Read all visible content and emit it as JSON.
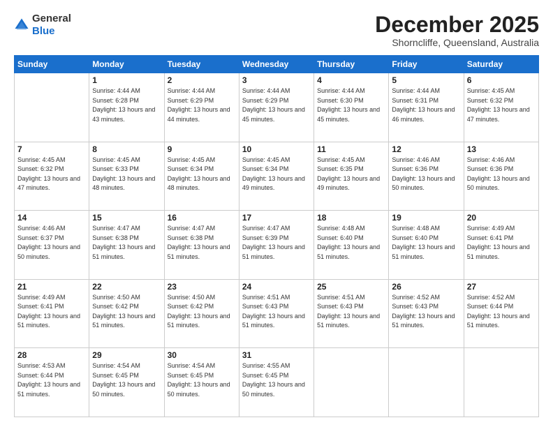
{
  "header": {
    "logo": {
      "general": "General",
      "blue": "Blue"
    },
    "title": "December 2025",
    "subtitle": "Shorncliffe, Queensland, Australia"
  },
  "calendar": {
    "weekdays": [
      "Sunday",
      "Monday",
      "Tuesday",
      "Wednesday",
      "Thursday",
      "Friday",
      "Saturday"
    ],
    "weeks": [
      [
        {
          "day": "",
          "empty": true
        },
        {
          "day": "1",
          "sunrise": "Sunrise: 4:44 AM",
          "sunset": "Sunset: 6:28 PM",
          "daylight": "Daylight: 13 hours and 43 minutes."
        },
        {
          "day": "2",
          "sunrise": "Sunrise: 4:44 AM",
          "sunset": "Sunset: 6:29 PM",
          "daylight": "Daylight: 13 hours and 44 minutes."
        },
        {
          "day": "3",
          "sunrise": "Sunrise: 4:44 AM",
          "sunset": "Sunset: 6:29 PM",
          "daylight": "Daylight: 13 hours and 45 minutes."
        },
        {
          "day": "4",
          "sunrise": "Sunrise: 4:44 AM",
          "sunset": "Sunset: 6:30 PM",
          "daylight": "Daylight: 13 hours and 45 minutes."
        },
        {
          "day": "5",
          "sunrise": "Sunrise: 4:44 AM",
          "sunset": "Sunset: 6:31 PM",
          "daylight": "Daylight: 13 hours and 46 minutes."
        },
        {
          "day": "6",
          "sunrise": "Sunrise: 4:45 AM",
          "sunset": "Sunset: 6:32 PM",
          "daylight": "Daylight: 13 hours and 47 minutes."
        }
      ],
      [
        {
          "day": "7",
          "sunrise": "Sunrise: 4:45 AM",
          "sunset": "Sunset: 6:32 PM",
          "daylight": "Daylight: 13 hours and 47 minutes."
        },
        {
          "day": "8",
          "sunrise": "Sunrise: 4:45 AM",
          "sunset": "Sunset: 6:33 PM",
          "daylight": "Daylight: 13 hours and 48 minutes."
        },
        {
          "day": "9",
          "sunrise": "Sunrise: 4:45 AM",
          "sunset": "Sunset: 6:34 PM",
          "daylight": "Daylight: 13 hours and 48 minutes."
        },
        {
          "day": "10",
          "sunrise": "Sunrise: 4:45 AM",
          "sunset": "Sunset: 6:34 PM",
          "daylight": "Daylight: 13 hours and 49 minutes."
        },
        {
          "day": "11",
          "sunrise": "Sunrise: 4:45 AM",
          "sunset": "Sunset: 6:35 PM",
          "daylight": "Daylight: 13 hours and 49 minutes."
        },
        {
          "day": "12",
          "sunrise": "Sunrise: 4:46 AM",
          "sunset": "Sunset: 6:36 PM",
          "daylight": "Daylight: 13 hours and 50 minutes."
        },
        {
          "day": "13",
          "sunrise": "Sunrise: 4:46 AM",
          "sunset": "Sunset: 6:36 PM",
          "daylight": "Daylight: 13 hours and 50 minutes."
        }
      ],
      [
        {
          "day": "14",
          "sunrise": "Sunrise: 4:46 AM",
          "sunset": "Sunset: 6:37 PM",
          "daylight": "Daylight: 13 hours and 50 minutes."
        },
        {
          "day": "15",
          "sunrise": "Sunrise: 4:47 AM",
          "sunset": "Sunset: 6:38 PM",
          "daylight": "Daylight: 13 hours and 51 minutes."
        },
        {
          "day": "16",
          "sunrise": "Sunrise: 4:47 AM",
          "sunset": "Sunset: 6:38 PM",
          "daylight": "Daylight: 13 hours and 51 minutes."
        },
        {
          "day": "17",
          "sunrise": "Sunrise: 4:47 AM",
          "sunset": "Sunset: 6:39 PM",
          "daylight": "Daylight: 13 hours and 51 minutes."
        },
        {
          "day": "18",
          "sunrise": "Sunrise: 4:48 AM",
          "sunset": "Sunset: 6:40 PM",
          "daylight": "Daylight: 13 hours and 51 minutes."
        },
        {
          "day": "19",
          "sunrise": "Sunrise: 4:48 AM",
          "sunset": "Sunset: 6:40 PM",
          "daylight": "Daylight: 13 hours and 51 minutes."
        },
        {
          "day": "20",
          "sunrise": "Sunrise: 4:49 AM",
          "sunset": "Sunset: 6:41 PM",
          "daylight": "Daylight: 13 hours and 51 minutes."
        }
      ],
      [
        {
          "day": "21",
          "sunrise": "Sunrise: 4:49 AM",
          "sunset": "Sunset: 6:41 PM",
          "daylight": "Daylight: 13 hours and 51 minutes."
        },
        {
          "day": "22",
          "sunrise": "Sunrise: 4:50 AM",
          "sunset": "Sunset: 6:42 PM",
          "daylight": "Daylight: 13 hours and 51 minutes."
        },
        {
          "day": "23",
          "sunrise": "Sunrise: 4:50 AM",
          "sunset": "Sunset: 6:42 PM",
          "daylight": "Daylight: 13 hours and 51 minutes."
        },
        {
          "day": "24",
          "sunrise": "Sunrise: 4:51 AM",
          "sunset": "Sunset: 6:43 PM",
          "daylight": "Daylight: 13 hours and 51 minutes."
        },
        {
          "day": "25",
          "sunrise": "Sunrise: 4:51 AM",
          "sunset": "Sunset: 6:43 PM",
          "daylight": "Daylight: 13 hours and 51 minutes."
        },
        {
          "day": "26",
          "sunrise": "Sunrise: 4:52 AM",
          "sunset": "Sunset: 6:43 PM",
          "daylight": "Daylight: 13 hours and 51 minutes."
        },
        {
          "day": "27",
          "sunrise": "Sunrise: 4:52 AM",
          "sunset": "Sunset: 6:44 PM",
          "daylight": "Daylight: 13 hours and 51 minutes."
        }
      ],
      [
        {
          "day": "28",
          "sunrise": "Sunrise: 4:53 AM",
          "sunset": "Sunset: 6:44 PM",
          "daylight": "Daylight: 13 hours and 51 minutes."
        },
        {
          "day": "29",
          "sunrise": "Sunrise: 4:54 AM",
          "sunset": "Sunset: 6:45 PM",
          "daylight": "Daylight: 13 hours and 50 minutes."
        },
        {
          "day": "30",
          "sunrise": "Sunrise: 4:54 AM",
          "sunset": "Sunset: 6:45 PM",
          "daylight": "Daylight: 13 hours and 50 minutes."
        },
        {
          "day": "31",
          "sunrise": "Sunrise: 4:55 AM",
          "sunset": "Sunset: 6:45 PM",
          "daylight": "Daylight: 13 hours and 50 minutes."
        },
        {
          "day": "",
          "empty": true
        },
        {
          "day": "",
          "empty": true
        },
        {
          "day": "",
          "empty": true
        }
      ]
    ]
  }
}
